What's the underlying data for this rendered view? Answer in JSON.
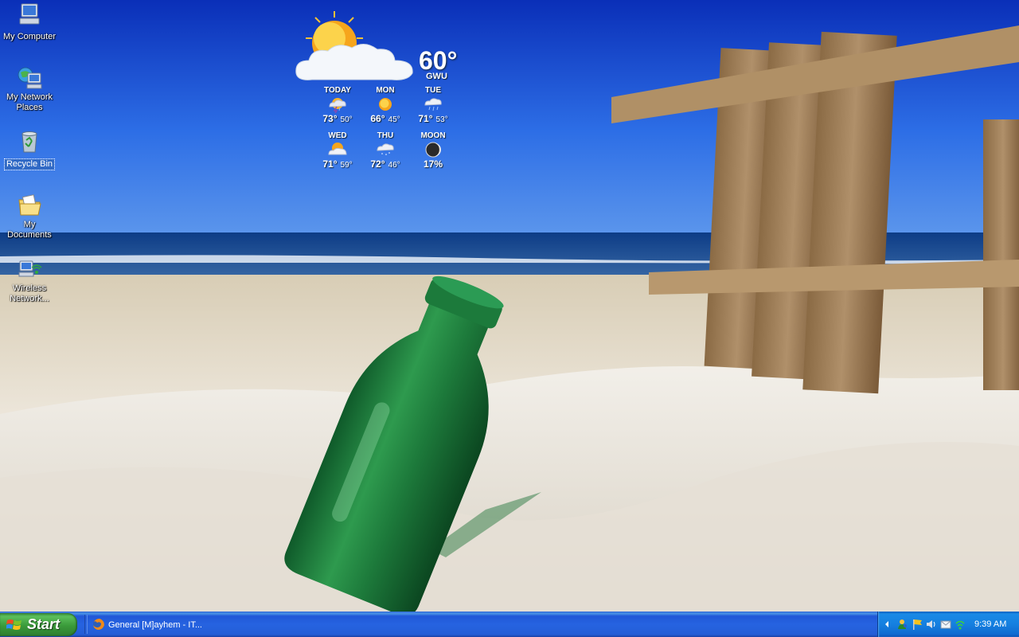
{
  "desktop": {
    "icons": [
      {
        "label": "My Computer",
        "icon": "my-computer-icon"
      },
      {
        "label": "My Network Places",
        "label_line1": "My Network",
        "label_line2": "Places",
        "icon": "network-places-icon"
      },
      {
        "label": "Recycle Bin",
        "icon": "recycle-bin-icon",
        "selected": true
      },
      {
        "label": "My Documents",
        "icon": "my-documents-icon"
      },
      {
        "label": "Wireless Network...",
        "label_line1": "Wireless",
        "label_line2": "Network...",
        "icon": "wireless-network-icon"
      }
    ]
  },
  "weather": {
    "current_temp": "60°",
    "location": "GWU",
    "current_icon": "partly-cloudy-icon",
    "forecast": [
      {
        "day": "TODAY",
        "high": "73°",
        "low": "50°",
        "icon": "thunderstorm-icon"
      },
      {
        "day": "MON",
        "high": "66°",
        "low": "45°",
        "icon": "sunny-icon"
      },
      {
        "day": "TUE",
        "high": "71°",
        "low": "53°",
        "icon": "rain-icon"
      },
      {
        "day": "WED",
        "high": "71°",
        "low": "59°",
        "icon": "partly-cloudy-icon"
      },
      {
        "day": "THU",
        "high": "72°",
        "low": "46°",
        "icon": "light-rain-icon"
      },
      {
        "day": "MOON",
        "value": "17%",
        "icon": "moon-icon"
      }
    ]
  },
  "taskbar": {
    "start_label": "Start",
    "tasks": [
      {
        "label": "General [M]ayhem - IT...",
        "icon": "firefox-icon"
      }
    ],
    "tray": {
      "icons": [
        "show-hidden-icon",
        "messenger-icon",
        "flag-icon",
        "volume-icon",
        "mail-icon",
        "wifi-signal-icon"
      ],
      "clock": "9:39 AM"
    }
  },
  "colors": {
    "taskbar_blue": "#245ed7",
    "start_green": "#3a9a3a",
    "tray_blue": "#1580e0",
    "selection_blue": "#316ac5"
  }
}
